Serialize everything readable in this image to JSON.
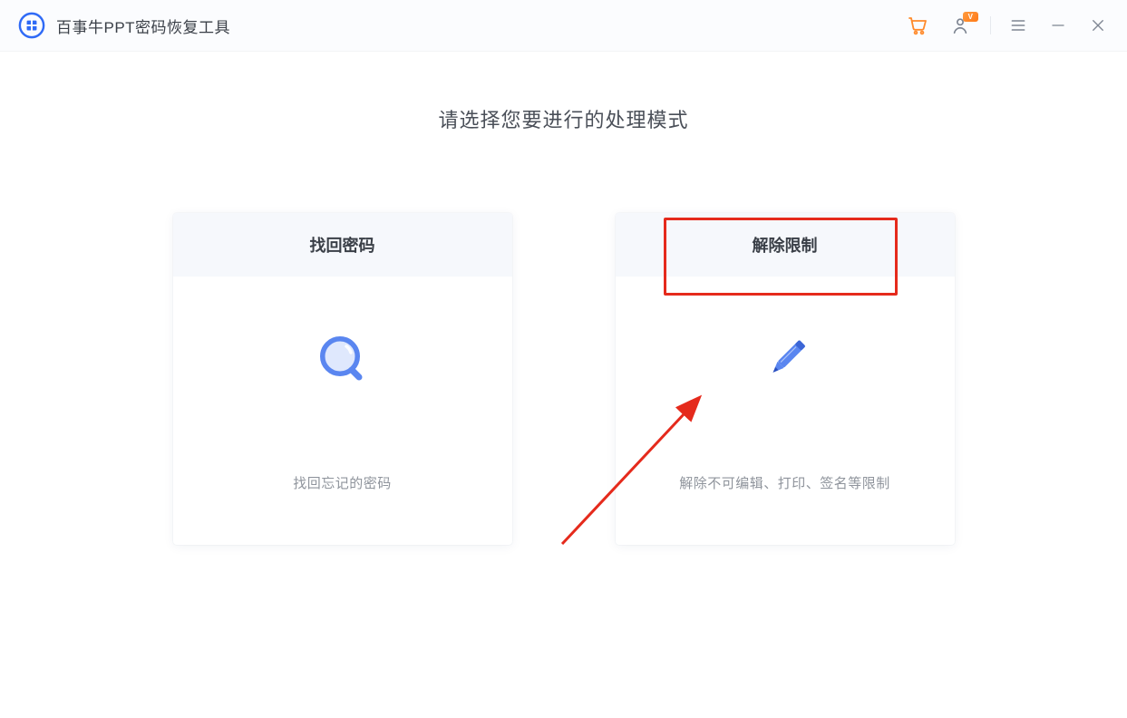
{
  "app": {
    "title": "百事牛PPT密码恢复工具"
  },
  "header": {
    "vip_badge": "V",
    "icons": {
      "cart": "cart-icon",
      "account": "account-icon",
      "menu": "menu-icon",
      "minimize": "minimize-icon",
      "close": "close-icon"
    }
  },
  "main": {
    "heading": "请选择您要进行的处理模式",
    "cards": [
      {
        "id": "recover",
        "title": "找回密码",
        "icon": "magnifier-icon",
        "description": "找回忘记的密码"
      },
      {
        "id": "unlock",
        "title": "解除限制",
        "icon": "pencil-icon",
        "description": "解除不可编辑、打印、签名等限制"
      }
    ]
  },
  "annotation": {
    "highlight_target": "unlock",
    "arrow": true
  },
  "colors": {
    "accent": "#2f6af6",
    "orange": "#ff8a2b",
    "red": "#e52a1c"
  }
}
